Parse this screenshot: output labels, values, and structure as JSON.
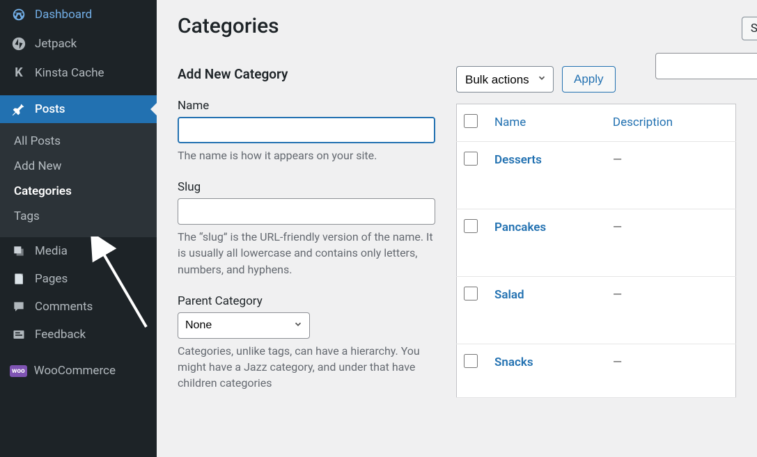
{
  "sidebar": {
    "items": [
      {
        "label": "Dashboard",
        "icon": "dashboard"
      },
      {
        "label": "Jetpack",
        "icon": "jetpack"
      },
      {
        "label": "Kinsta Cache",
        "icon": "kinsta"
      }
    ],
    "posts_label": "Posts",
    "posts_sub": [
      {
        "label": "All Posts"
      },
      {
        "label": "Add New"
      },
      {
        "label": "Categories"
      },
      {
        "label": "Tags"
      }
    ],
    "after": [
      {
        "label": "Media",
        "icon": "media"
      },
      {
        "label": "Pages",
        "icon": "pages"
      },
      {
        "label": "Comments",
        "icon": "comments"
      },
      {
        "label": "Feedback",
        "icon": "feedback"
      },
      {
        "label": "WooCommerce",
        "icon": "woocommerce"
      }
    ]
  },
  "page": {
    "title": "Categories"
  },
  "form": {
    "heading": "Add New Category",
    "name_label": "Name",
    "name_help": "The name is how it appears on your site.",
    "slug_label": "Slug",
    "slug_help": "The “slug” is the URL-friendly version of the name. It is usually all lowercase and contains only letters, numbers, and hyphens.",
    "parent_label": "Parent Category",
    "parent_selected": "None",
    "parent_help": "Categories, unlike tags, can have a hierarchy. You might have a Jazz category, and under that have children categories"
  },
  "table": {
    "bulk_label": "Bulk actions",
    "apply_label": "Apply",
    "col_name": "Name",
    "col_desc": "Description",
    "rows": [
      {
        "name": "Desserts",
        "desc": "—"
      },
      {
        "name": "Pancakes",
        "desc": "—"
      },
      {
        "name": "Salad",
        "desc": "—"
      },
      {
        "name": "Snacks",
        "desc": "—"
      }
    ]
  }
}
